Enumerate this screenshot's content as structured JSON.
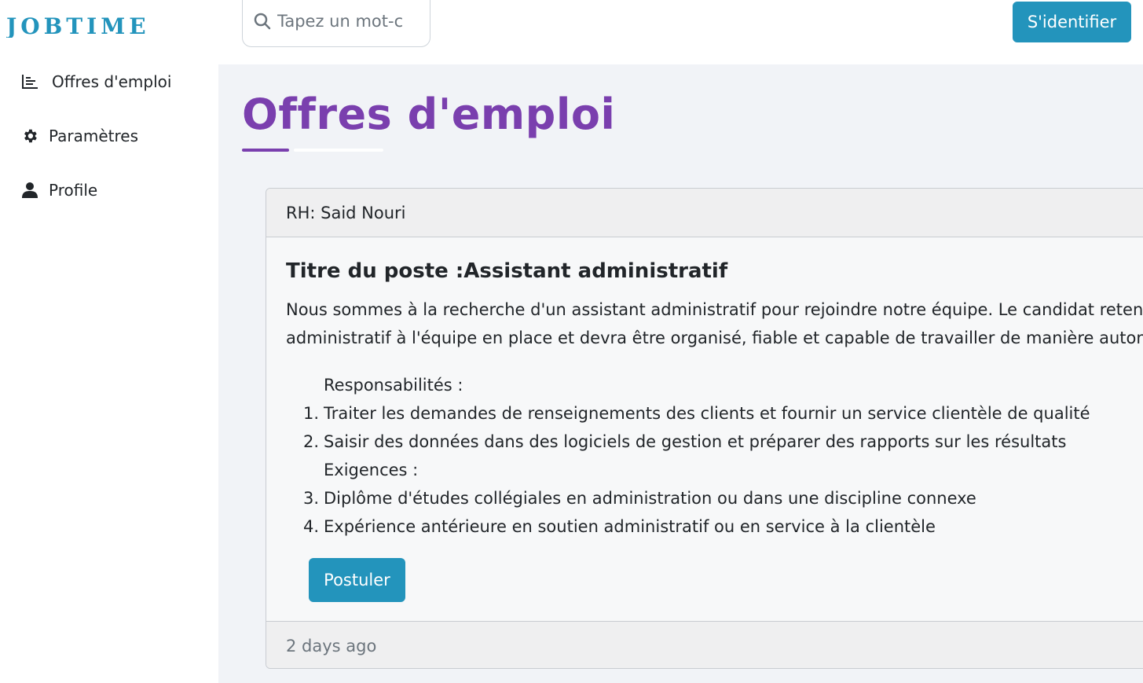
{
  "brand": {
    "logo_text": "JOBTIME",
    "logo_color": "#2394bc"
  },
  "sidebar": {
    "items": [
      {
        "label": "Offres d'emploi",
        "icon": "bar-chart-icon"
      },
      {
        "label": "Paramètres",
        "icon": "gear-icon"
      },
      {
        "label": "Profile",
        "icon": "user-icon"
      }
    ]
  },
  "header": {
    "search_placeholder": "Tapez un mot-clé",
    "login_label": "S'identifier"
  },
  "main": {
    "page_title": "Offres d'emploi",
    "accent_color": "#7a3fae"
  },
  "job": {
    "recruiter": "RH: Said Nouri",
    "title": "Titre du poste :Assistant administratif",
    "description_line1": "Nous sommes à la recherche d'un assistant administratif pour rejoindre notre équipe. Le candidat retenu",
    "description_line2": "administratif à l'équipe en place et devra être organisé, fiable et capable de travailler de manière autonome",
    "responsibilities_heading": "Responsabilités :",
    "items": [
      {
        "num": "1.",
        "text": "Traiter les demandes de renseignements des clients et fournir un service clientèle de qualité"
      },
      {
        "num": "2.",
        "text": "Saisir des données dans des logiciels de gestion et préparer des rapports sur les résultats"
      },
      {
        "num": "3.",
        "text": "Diplôme d'études collégiales en administration ou dans une discipline connexe"
      },
      {
        "num": "4.",
        "text": "Expérience antérieure en soutien administratif ou en service à la clientèle"
      }
    ],
    "requirements_heading": "Exigences :",
    "apply_label": "Postuler",
    "posted": "2 days ago"
  }
}
